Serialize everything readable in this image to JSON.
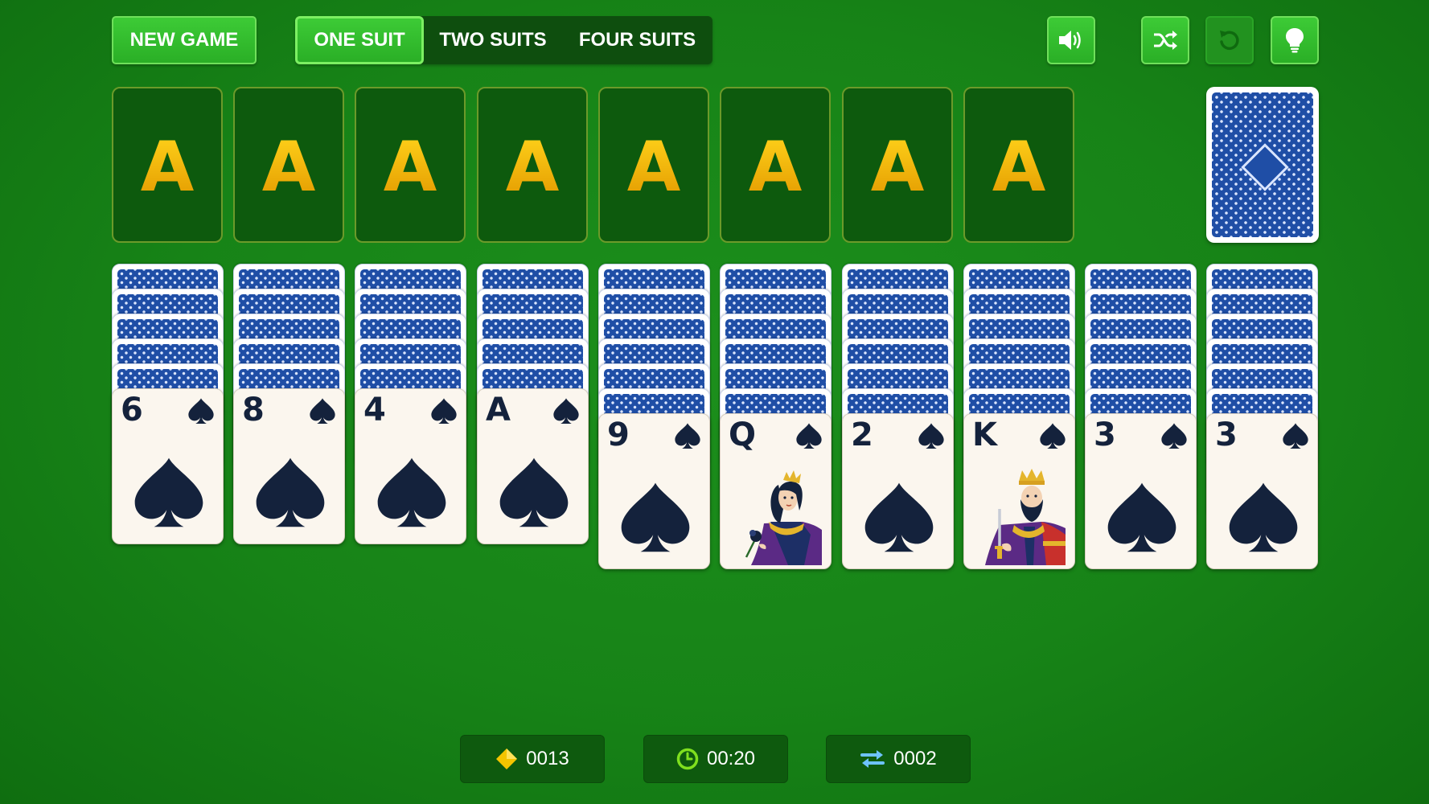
{
  "toolbar": {
    "new_game_label": "NEW GAME",
    "suit_options": [
      "ONE SUIT",
      "TWO SUITS",
      "FOUR SUITS"
    ],
    "selected_suit": "ONE SUIT",
    "icons": [
      "speaker-icon",
      "shuffle-icon",
      "undo-icon",
      "hint-bulb-icon"
    ]
  },
  "foundations": [
    "A",
    "A",
    "A",
    "A",
    "A",
    "A",
    "A",
    "A"
  ],
  "stock": {
    "icon": "card-back"
  },
  "tableau": [
    {
      "face_down": 5,
      "rank": "6",
      "suit": "spade"
    },
    {
      "face_down": 5,
      "rank": "8",
      "suit": "spade"
    },
    {
      "face_down": 5,
      "rank": "4",
      "suit": "spade"
    },
    {
      "face_down": 5,
      "rank": "A",
      "suit": "spade"
    },
    {
      "face_down": 6,
      "rank": "9",
      "suit": "spade"
    },
    {
      "face_down": 6,
      "rank": "Q",
      "suit": "spade"
    },
    {
      "face_down": 6,
      "rank": "2",
      "suit": "spade"
    },
    {
      "face_down": 6,
      "rank": "K",
      "suit": "spade"
    },
    {
      "face_down": 6,
      "rank": "3",
      "suit": "spade"
    },
    {
      "face_down": 6,
      "rank": "3",
      "suit": "spade"
    }
  ],
  "stats": {
    "score": "0013",
    "time": "00:20",
    "moves": "0002"
  },
  "colors": {
    "felt": "#178317",
    "button_green": "#2fb82a",
    "foundation_letter": "#f2b800",
    "card_back": "#1f4ea6",
    "suit_ink": "#14223c"
  }
}
